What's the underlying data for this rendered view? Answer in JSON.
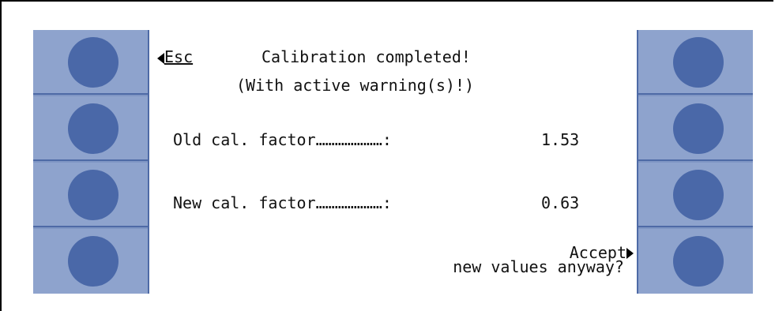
{
  "screen": {
    "esc_label": "Esc",
    "title": "Calibration completed!",
    "subtitle": "(With active warning(s)!)",
    "old_factor": {
      "label": "Old cal. factor…………………:",
      "value": "1.53"
    },
    "new_factor": {
      "label": "New cal. factor…………………:",
      "value": "0.63"
    },
    "accept_line1": "Accept",
    "accept_line2": "new values anyway?"
  },
  "colors": {
    "panel": "#8ea3cd",
    "button": "#4a68a8",
    "divider": "#4e6aa6",
    "screen_bg": "#ffffff"
  }
}
